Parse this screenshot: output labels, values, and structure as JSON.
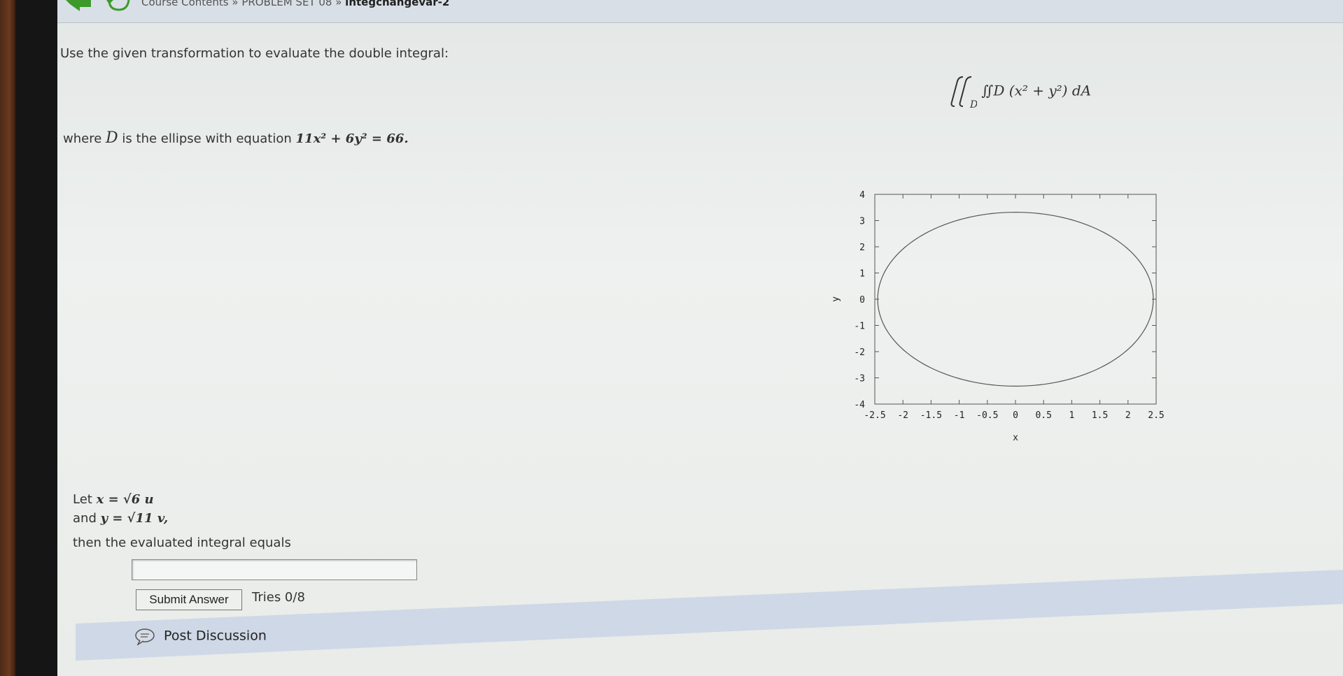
{
  "breadcrumb": {
    "path": "Course Contents » PROBLEM SET 08 » ",
    "current": "integchangevar-2"
  },
  "problem": {
    "intro": "Use the given transformation to evaluate the double integral:",
    "integral_expression": "∬D (x² + y²) dA",
    "where_prefix": "where",
    "region_symbol": "D",
    "where_middle": "is the ellipse with equation",
    "ellipse_equation": "11x² + 6y² = 66.",
    "let_prefix": "Let",
    "sub_x": "x = √6 u",
    "and_prefix": "and",
    "sub_y": "y = √11 v,",
    "result_prompt": "then the evaluated integral equals"
  },
  "answer": {
    "value": "",
    "submit_label": "Submit Answer",
    "tries": "Tries 0/8"
  },
  "discussion": {
    "label": "Post Discussion",
    "icon": "discussion-icon"
  },
  "chart_data": {
    "type": "line",
    "title": "",
    "xlabel": "x",
    "ylabel": "y",
    "xlim": [
      -2.5,
      2.5
    ],
    "ylim": [
      -4,
      4
    ],
    "xticks": [
      "-2.5",
      "-2",
      "-1.5",
      "-1",
      "-0.5",
      "0",
      "0.5",
      "1",
      "1.5",
      "2",
      "2.5"
    ],
    "yticks": [
      "4",
      "3",
      "2",
      "1",
      "0",
      "-1",
      "-2",
      "-3",
      "-4"
    ],
    "series": [
      {
        "curve": "ellipse 11x^2 + 6y^2 = 66",
        "a": 2.449,
        "b": 3.317,
        "color": "#555555"
      }
    ],
    "grid": false
  }
}
